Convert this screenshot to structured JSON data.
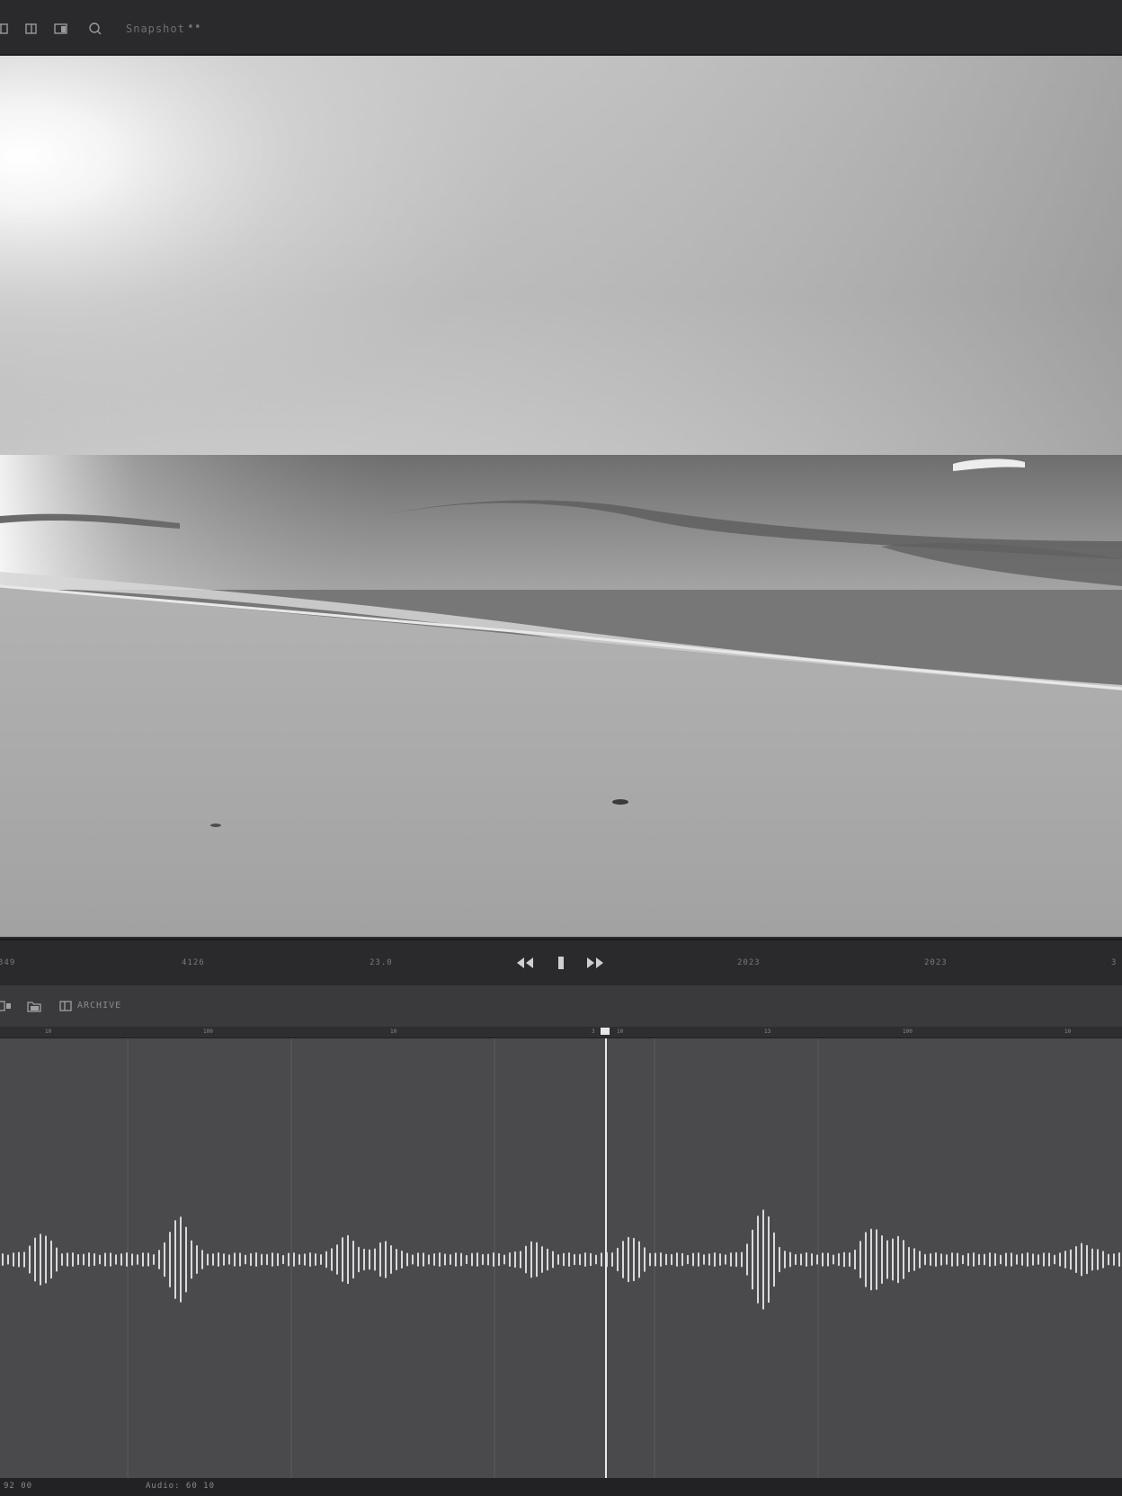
{
  "toolbar": {
    "label": "Snapshot",
    "more": "••"
  },
  "transport": {
    "timecodes": [
      "349",
      "4126",
      "23.0",
      "2023",
      "2023",
      "3"
    ],
    "rewind_label": "◀◀",
    "play_label": "▮",
    "forward_label": "▶▶"
  },
  "timeline_toolbar": {
    "label": "ARCHIVE"
  },
  "ruler": {
    "ticks": [
      "10",
      "100",
      "10",
      "3",
      "10",
      "13",
      "100",
      "10"
    ]
  },
  "status": {
    "left": "92  00",
    "middle": "Audio: 60  10"
  },
  "colors": {
    "waveform": "#d9d9db",
    "playhead": "#e8e8ea",
    "track_bg": "#4a4a4c"
  },
  "playhead_position": 0.54
}
